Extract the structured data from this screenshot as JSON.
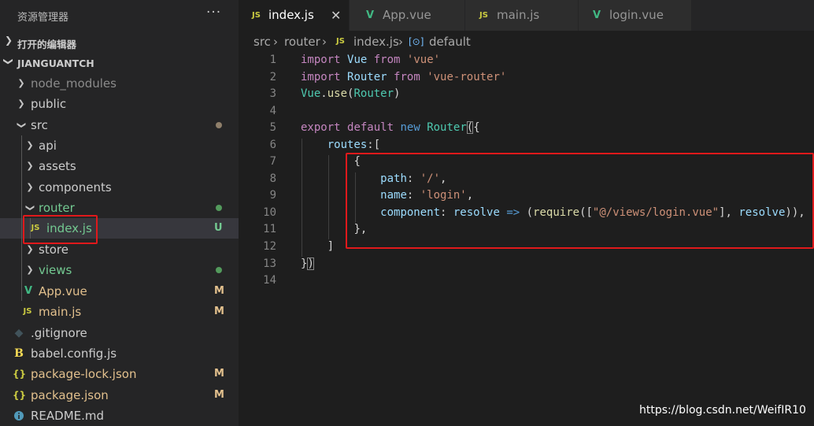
{
  "explorer": {
    "title": "资源管理器",
    "more_label": "···",
    "open_editors_label": "打开的编辑器",
    "project_label": "JIANGUANTCH"
  },
  "tree": [
    {
      "name": "node_modules",
      "type": "folder",
      "state": "closed",
      "color": "#8b8b8b"
    },
    {
      "name": "public",
      "type": "folder",
      "state": "closed",
      "color": "#cccccc"
    },
    {
      "name": "src",
      "type": "folder",
      "state": "open",
      "color": "#cccccc",
      "dot": "#8f7f6a"
    },
    {
      "name": "api",
      "type": "folder",
      "state": "closed",
      "color": "#cccccc"
    },
    {
      "name": "assets",
      "type": "folder",
      "state": "closed",
      "color": "#cccccc"
    },
    {
      "name": "components",
      "type": "folder",
      "state": "closed",
      "color": "#cccccc"
    },
    {
      "name": "router",
      "type": "folder",
      "state": "open",
      "color": "#73c991",
      "dot": "#539a5c"
    },
    {
      "name": "index.js",
      "type": "file",
      "icon": "JS",
      "color": "#73c991",
      "badge": "U",
      "badge_color": "#73c991"
    },
    {
      "name": "store",
      "type": "folder",
      "state": "closed",
      "color": "#cccccc"
    },
    {
      "name": "views",
      "type": "folder",
      "state": "closed",
      "color": "#73c991",
      "dot": "#539a5c"
    },
    {
      "name": "App.vue",
      "type": "file",
      "icon": "V",
      "color": "#e2c08d",
      "badge": "M",
      "badge_color": "#e2c08d"
    },
    {
      "name": "main.js",
      "type": "file",
      "icon": "JS",
      "color": "#e2c08d",
      "badge": "M",
      "badge_color": "#e2c08d"
    },
    {
      "name": ".gitignore",
      "type": "file",
      "icon": "◆",
      "color": "#cccccc"
    },
    {
      "name": "babel.config.js",
      "type": "file",
      "icon": "B",
      "color": "#cccccc"
    },
    {
      "name": "package-lock.json",
      "type": "file",
      "icon": "{}",
      "color": "#e2c08d",
      "badge": "M",
      "badge_color": "#e2c08d"
    },
    {
      "name": "package.json",
      "type": "file",
      "icon": "{}",
      "color": "#e2c08d",
      "badge": "M",
      "badge_color": "#e2c08d"
    },
    {
      "name": "README.md",
      "type": "file",
      "icon": "i",
      "color": "#cccccc"
    }
  ],
  "tabs": [
    {
      "label": "index.js",
      "icon": "JS",
      "active": true,
      "close": "✕"
    },
    {
      "label": "App.vue",
      "icon": "V",
      "active": false
    },
    {
      "label": "main.js",
      "icon": "JS",
      "active": false
    },
    {
      "label": "login.vue",
      "icon": "V",
      "active": false
    }
  ],
  "breadcrumb": {
    "part1": "src",
    "sep": "›",
    "part2": "router",
    "file_icon": "JS",
    "part3": "index.js",
    "symbol_icon": "[⊙]",
    "part4": "default"
  },
  "line_numbers": [
    "1",
    "2",
    "3",
    "4",
    "5",
    "6",
    "7",
    "8",
    "9",
    "10",
    "11",
    "12",
    "13",
    "14"
  ],
  "code": {
    "l1": [
      "import",
      " ",
      "Vue",
      " ",
      "from",
      " ",
      "'vue'"
    ],
    "l2": [
      "import",
      " ",
      "Router",
      " ",
      "from",
      " ",
      "'vue-router'"
    ],
    "l3": [
      "Vue",
      ".",
      "use",
      "(",
      "Router",
      ")"
    ],
    "l5": [
      "export",
      " ",
      "default",
      " ",
      "new",
      " ",
      "Router",
      "(",
      "{"
    ],
    "l6": [
      "routes",
      ":["
    ],
    "l7": [
      "{"
    ],
    "l8": [
      "path",
      ": ",
      "'/'",
      ","
    ],
    "l9": [
      "name",
      ": ",
      "'login'",
      ","
    ],
    "l10": [
      "component",
      ": ",
      "resolve",
      " ",
      "=>",
      " (",
      "require",
      "([",
      "\"@/views/login.vue\"",
      "], ",
      "resolve",
      ")),"
    ],
    "l11": [
      "},"
    ],
    "l12": [
      "]"
    ],
    "l13": [
      "}",
      ")"
    ]
  },
  "watermark": "https://blog.csdn.net/WeifIR10",
  "colors": {
    "annotation_red": "#e0191b",
    "js_icon": "#cbcb41",
    "vue_icon": "#41b883",
    "git_untracked": "#73c991",
    "git_modified": "#e2c08d"
  }
}
